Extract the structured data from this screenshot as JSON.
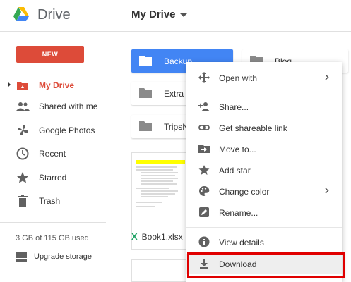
{
  "header": {
    "app_title": "Drive",
    "location": "My Drive"
  },
  "sidebar": {
    "new_label": "NEW",
    "items": [
      {
        "label": "My Drive",
        "active": true,
        "icon": "my-drive-icon"
      },
      {
        "label": "Shared with me",
        "icon": "people-icon"
      },
      {
        "label": "Google Photos",
        "icon": "pinwheel-icon"
      },
      {
        "label": "Recent",
        "icon": "clock-icon"
      },
      {
        "label": "Starred",
        "icon": "star-icon"
      },
      {
        "label": "Trash",
        "icon": "trash-icon"
      }
    ],
    "storage": "3 GB of 115 GB used",
    "upgrade": "Upgrade storage"
  },
  "folders": [
    {
      "name": "Backup",
      "selected": true
    },
    {
      "name": "Blog"
    },
    {
      "name": "Extra f"
    },
    {
      "name": "TripsN"
    }
  ],
  "files": [
    {
      "name": "Book1.xlsx",
      "type": "excel"
    }
  ],
  "context_menu": {
    "items": [
      {
        "label": "Open with",
        "icon": "move-arrows-icon",
        "submenu": true
      },
      {
        "label": "Share...",
        "icon": "add-person-icon"
      },
      {
        "label": "Get shareable link",
        "icon": "link-icon"
      },
      {
        "label": "Move to...",
        "icon": "move-folder-icon"
      },
      {
        "label": "Add star",
        "icon": "star-icon"
      },
      {
        "label": "Change color",
        "icon": "palette-icon",
        "submenu": true
      },
      {
        "label": "Rename...",
        "icon": "pencil-icon"
      },
      {
        "label": "View details",
        "icon": "info-icon"
      },
      {
        "label": "Download",
        "icon": "download-icon",
        "highlighted": true
      }
    ]
  },
  "colors": {
    "accent_red": "#dd4b39",
    "selected_blue": "#4285f4",
    "highlight_border": "#e00000"
  }
}
